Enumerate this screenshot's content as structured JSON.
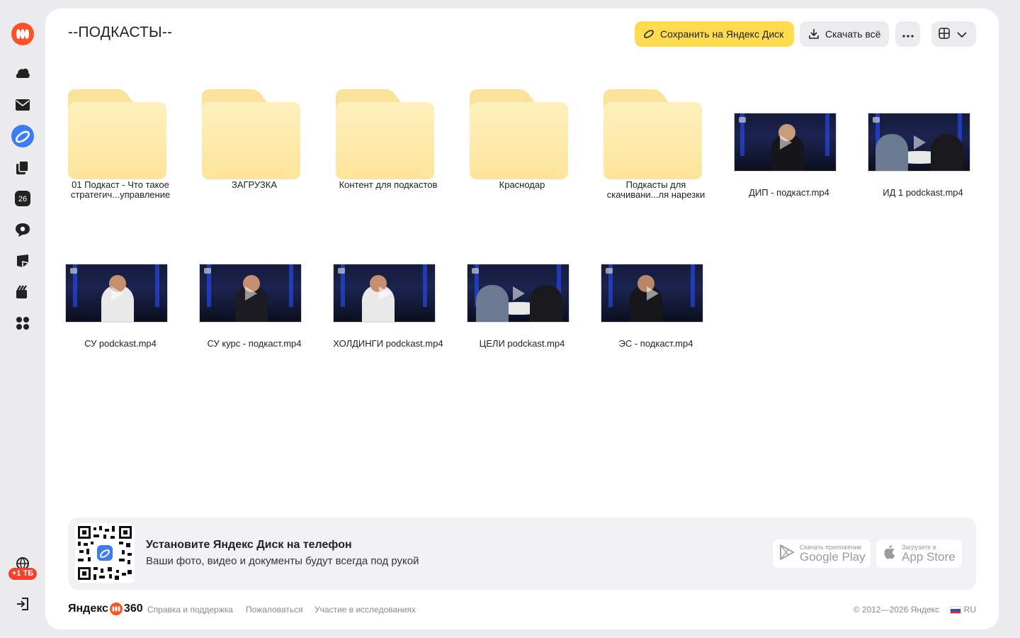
{
  "rail": {
    "logo_icon": "yandex-360-logo-icon",
    "items": [
      {
        "name": "cloud-icon"
      },
      {
        "name": "mail-icon"
      },
      {
        "name": "disk-icon",
        "active": true
      },
      {
        "name": "documents-icon"
      },
      {
        "name": "calendar-icon",
        "badge": "26"
      },
      {
        "name": "messenger-icon"
      },
      {
        "name": "notes-icon"
      },
      {
        "name": "telemost-icon"
      },
      {
        "name": "all-services-icon"
      }
    ],
    "storage_badge": "+1 ТБ",
    "logout_icon": "logout-icon"
  },
  "page": {
    "title": "--ПОДКАСТЫ--"
  },
  "toolbar": {
    "save_label": "Сохранить на Яндекс Диск",
    "download_label": "Скачать всё",
    "more_icon": "more-icon",
    "view_icon": "grid-view-icon"
  },
  "files": [
    {
      "type": "folder",
      "name": "01 Подкаст - Что такое стратегич...управление"
    },
    {
      "type": "folder",
      "name": "ЗАГРУЗКА"
    },
    {
      "type": "folder",
      "name": "Контент для подкастов"
    },
    {
      "type": "folder",
      "name": "Краснодар"
    },
    {
      "type": "folder",
      "name": "Подкасты для скачивани...ля нарезки"
    },
    {
      "type": "video",
      "name": "ДИП - подкаст.mp4"
    },
    {
      "type": "video",
      "name": "ИД 1 podckast.mp4"
    },
    {
      "type": "video",
      "name": "СУ podckast.mp4"
    },
    {
      "type": "video",
      "name": "СУ курс - подкаст.mp4"
    },
    {
      "type": "video",
      "name": "ХОЛДИНГИ podckast.mp4"
    },
    {
      "type": "video",
      "name": "ЦЕЛИ podckast.mp4"
    },
    {
      "type": "video",
      "name": "ЭС - подкаст.mp4"
    }
  ],
  "promo": {
    "title": "Установите Яндекс Диск на телефон",
    "subtitle": "Ваши фото, видео и документы будут всегда под рукой",
    "google_play": {
      "small": "Скачать приложение",
      "big": "Google Play"
    },
    "app_store": {
      "small": "Загрузите в",
      "big": "App Store"
    }
  },
  "footer": {
    "brand_left": "Яндекс",
    "brand_right": "360",
    "links": [
      "Справка и поддержка",
      "Пожаловаться",
      "Участие в исследованиях"
    ],
    "copyright": "© 2012—2026 Яндекс",
    "lang": "RU"
  },
  "colors": {
    "accent_yellow": "#ffdb4d",
    "brand_red": "#ff5226",
    "active_blue": "#3d7cf5",
    "folder": "#fde49a"
  }
}
